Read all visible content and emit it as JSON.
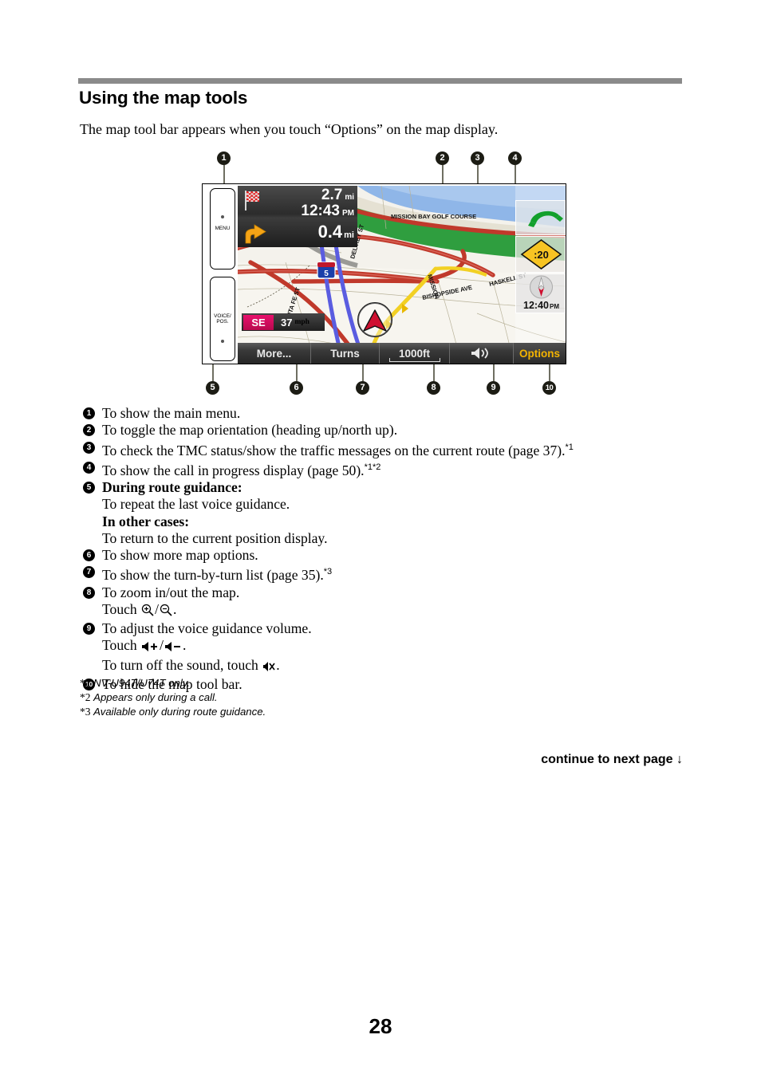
{
  "heading": "Using the map tools",
  "intro": "The map tool bar appears when you touch “Options” on the map display.",
  "figure": {
    "callout_numbers": [
      "1",
      "2",
      "3",
      "4",
      "5",
      "6",
      "7",
      "8",
      "9",
      "10"
    ],
    "device": {
      "hardware_buttons": [
        {
          "label": "MENU"
        },
        {
          "label_line1": "VOICE/",
          "label_line2": "POS."
        }
      ]
    },
    "screen": {
      "info_panel": {
        "destination_distance": "2.7",
        "destination_distance_unit": "mi",
        "eta": "12:43",
        "eta_ampm": "PM",
        "next_turn_distance": "0.4",
        "next_turn_distance_unit": "mi",
        "flag_icon": "checkered-flag-icon",
        "turn_arrow_icon": "turn-right-arrow-icon"
      },
      "status": {
        "heading_direction": "SE",
        "speed": "37",
        "speed_unit": "mph"
      },
      "widgets": {
        "call_icon": "phone-call-icon",
        "tmc_label": ":20",
        "tmc_icon": "traffic-diamond-icon",
        "compass_icon": "compass-icon",
        "clock": "12:40",
        "clock_ampm": "PM"
      },
      "map_labels": [
        "DEL REY ST",
        "MISSION BAY GOLF COURSE",
        "BISHOPSIDE AVE",
        "SANTA FE ST",
        "MISSION",
        "HASKELL ST",
        "5",
        "5"
      ],
      "toolbar": {
        "more_label": "More...",
        "turns_label": "Turns",
        "scale_label": "1000ft",
        "volume_icon": "speaker-icon",
        "options_label": "Options"
      }
    }
  },
  "list": [
    {
      "num": "1",
      "text": "To show the main menu."
    },
    {
      "num": "2",
      "text": "To toggle the map orientation (heading up/north up)."
    },
    {
      "num": "3",
      "text": "To check the TMC status/show the traffic messages on the current route (page 37).",
      "sup": "*1"
    },
    {
      "num": "4",
      "text": "To show the call in progress display (page 50).",
      "sup": "*1*2"
    },
    {
      "num": "5",
      "bold_head": "During route guidance:",
      "line2": "To repeat the last voice guidance.",
      "bold_head2": "In other cases:",
      "line4": "To return to the current position display."
    },
    {
      "num": "6",
      "text": "To show more map options."
    },
    {
      "num": "7",
      "text": "To show the turn-by-turn list (page 35).",
      "sup": "*3"
    },
    {
      "num": "8",
      "text": "To zoom in/out the map.",
      "touch_prefix": "Touch",
      "touch_suffix": "/",
      "touch_end": ".",
      "icons": [
        "zoom-in-icon",
        "zoom-out-icon"
      ]
    },
    {
      "num": "9",
      "text": "To adjust the voice guidance volume.",
      "touch_prefix": "Touch",
      "touch_suffix": "/",
      "touch_end": ".",
      "icons": [
        "volume-up-icon",
        "volume-down-icon"
      ],
      "mute_prefix": "To turn off the sound, touch",
      "mute_end": ".",
      "mute_icon": "mute-icon"
    },
    {
      "num": "10",
      "text": "To hide the map tool bar."
    }
  ],
  "footnotes": [
    {
      "marker": "*1",
      "text": "NV-U94T/U74T only."
    },
    {
      "marker": "*2",
      "text": "Appears only during a call."
    },
    {
      "marker": "*3",
      "text": "Available only during route guidance."
    }
  ],
  "continue_text": "continue to next page",
  "continue_arrow": "↓",
  "page_number": "28",
  "colors": {
    "rule": "#8a8a8a",
    "callout_bg": "#1c1c14",
    "options_text": "#f3b300",
    "heading_badge": "#e8106c",
    "tmc_diamond": "#f7c423",
    "interstate_shield": "#1a3faa",
    "route_line": "#5a5ce0"
  }
}
